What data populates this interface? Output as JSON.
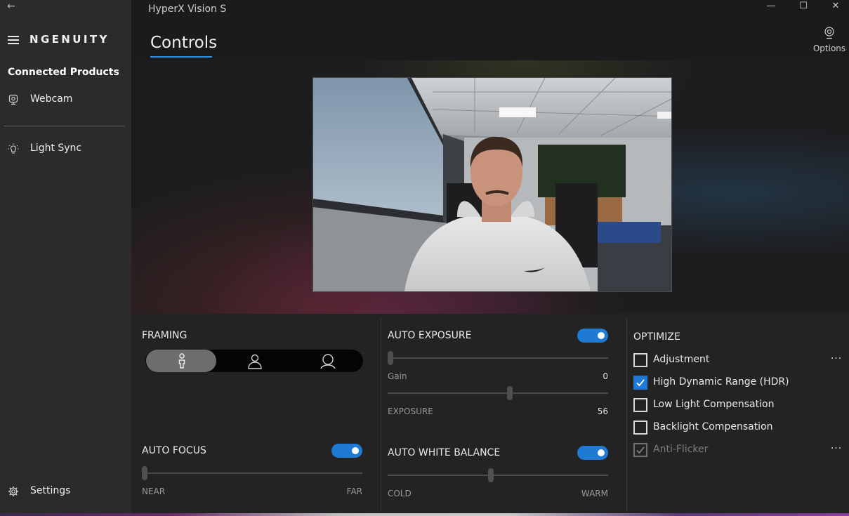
{
  "window": {
    "title": "HyperX Vision S",
    "controls": {
      "minimize": "—",
      "maximize": "☐",
      "close": "✕"
    }
  },
  "sidebar": {
    "back_icon": "←",
    "brand": "NGENUITY",
    "section_title": "Connected Products",
    "items": [
      {
        "label": "Webcam",
        "icon": "webcam-icon"
      },
      {
        "label": "Light Sync",
        "icon": "lightbulb-icon"
      }
    ],
    "settings": {
      "label": "Settings",
      "icon": "gear-icon"
    }
  },
  "header": {
    "page_title": "Controls",
    "options_label": "Options"
  },
  "framing": {
    "label": "FRAMING",
    "options": [
      "framing-full-icon",
      "framing-half-icon",
      "framing-close-icon"
    ],
    "selected": 0
  },
  "auto_focus": {
    "label": "AUTO FOCUS",
    "enabled": true,
    "min_label": "NEAR",
    "max_label": "FAR",
    "value_fraction": 0.0
  },
  "auto_exposure": {
    "label": "AUTO EXPOSURE",
    "enabled": true,
    "gain": {
      "label": "Gain",
      "value": "0",
      "value_fraction": 0.0
    },
    "exposure": {
      "label": "EXPOSURE",
      "value": "56",
      "value_fraction": 0.56
    }
  },
  "auto_white_balance": {
    "label": "AUTO WHITE BALANCE",
    "enabled": true,
    "min_label": "COLD",
    "max_label": "WARM",
    "value_fraction": 0.48
  },
  "optimize": {
    "label": "OPTIMIZE",
    "items": [
      {
        "label": "Adjustment",
        "checked": false,
        "disabled": false,
        "more": "···"
      },
      {
        "label": "High Dynamic Range (HDR)",
        "checked": true,
        "disabled": false
      },
      {
        "label": "Low Light Compensation",
        "checked": false,
        "disabled": false
      },
      {
        "label": "Backlight Compensation",
        "checked": false,
        "disabled": false
      },
      {
        "label": "Anti-Flicker",
        "checked": true,
        "disabled": true,
        "more": "···"
      }
    ]
  },
  "colors": {
    "accent": "#1f7ad6",
    "sidebar_bg": "#2b2b2b",
    "main_bg": "#1b1b1b"
  }
}
